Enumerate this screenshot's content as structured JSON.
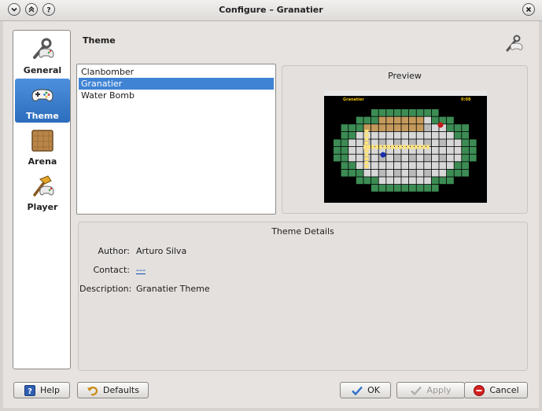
{
  "window": {
    "title": "Configure – Granatier"
  },
  "sidebar": {
    "items": [
      {
        "label": "General",
        "icon": "wrench-gamepad-icon"
      },
      {
        "label": "Theme",
        "icon": "gamepad-icon",
        "selected": true
      },
      {
        "label": "Arena",
        "icon": "arena-tile-icon"
      },
      {
        "label": "Player",
        "icon": "hammer-gamepad-icon"
      }
    ]
  },
  "page": {
    "title": "Theme",
    "icon": "theme-config-icon"
  },
  "themes": {
    "items": [
      "Clanbomber",
      "Granatier",
      "Water Bomb"
    ],
    "selected": "Granatier"
  },
  "preview": {
    "title": "Preview",
    "hud_player": "Granatier",
    "hud_time": "0:08"
  },
  "details": {
    "title": "Theme Details",
    "author_label": "Author:",
    "author_value": "Arturo Silva",
    "contact_label": "Contact:",
    "contact_value": "---",
    "description_label": "Description:",
    "description_value": "Granatier Theme"
  },
  "buttons": {
    "help": "Help",
    "defaults": "Defaults",
    "ok": "OK",
    "apply": "Apply",
    "cancel": "Cancel"
  },
  "colors": {
    "selection": "#3f83d4",
    "sidebar_selected": "#3a7ccb",
    "link": "#0a4bb8",
    "arena_wall": "#3c8c54",
    "arena_floor": "#d8d8d8",
    "crate": "#c49a5c"
  }
}
